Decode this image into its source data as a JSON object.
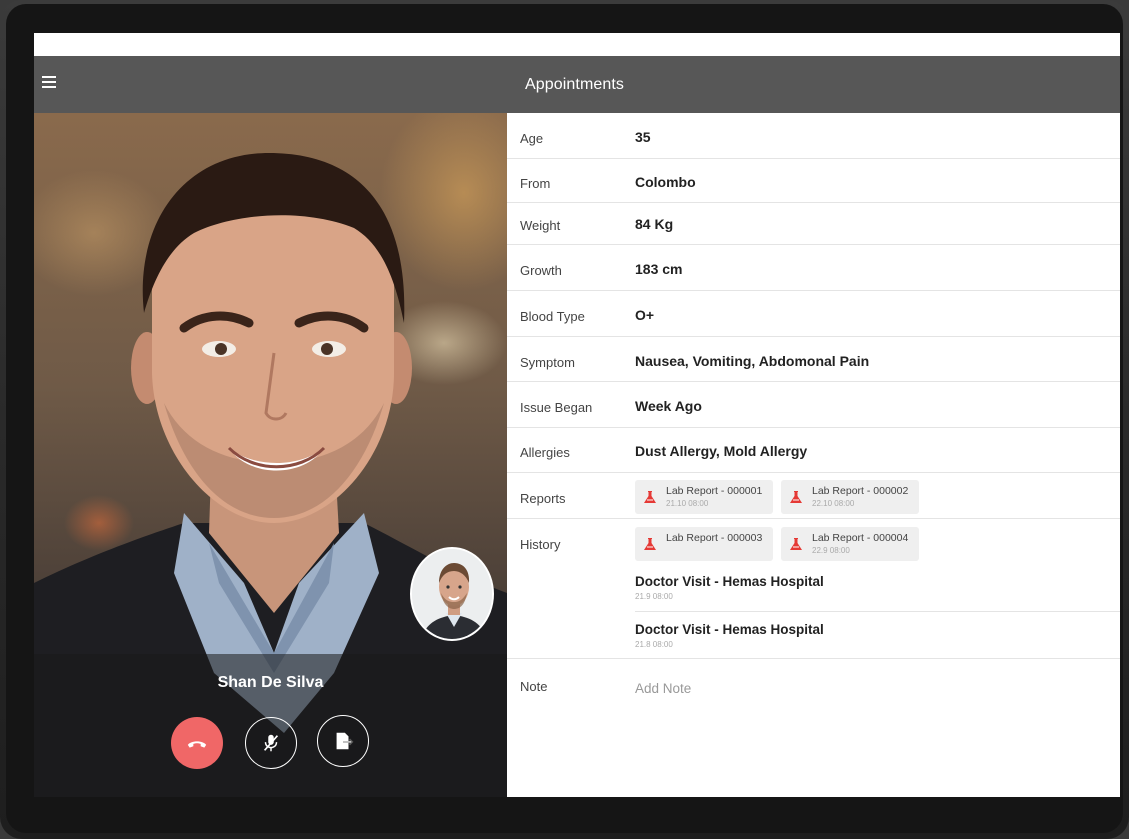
{
  "app": {
    "title": "Appointments"
  },
  "colors": {
    "header": "#575757",
    "end_call": "#f06767",
    "lab_icon": "#e53935"
  },
  "call": {
    "caller_name": "Shan De Silva",
    "buttons": [
      {
        "name": "end-call-button",
        "icon": "phone-hangup-icon"
      },
      {
        "name": "mute-button",
        "icon": "microphone-off-icon"
      },
      {
        "name": "share-button",
        "icon": "share-document-icon"
      }
    ]
  },
  "patient": {
    "rows": [
      {
        "label": "Age",
        "value": "35"
      },
      {
        "label": "From",
        "value": "Colombo"
      },
      {
        "label": "Weight",
        "value": "84 Kg"
      },
      {
        "label": "Growth",
        "value": "183 cm"
      },
      {
        "label": "Blood Type",
        "value": "O+"
      },
      {
        "label": "Symptom",
        "value": "Nausea, Vomiting, Abdomonal Pain"
      },
      {
        "label": "Issue Began",
        "value": "Week Ago"
      },
      {
        "label": "Allergies",
        "value": "Dust Allergy, Mold Allergy"
      }
    ],
    "reports_label": "Reports",
    "reports": [
      {
        "title": "Lab Report - 000001",
        "date": "21.10 08:00"
      },
      {
        "title": "Lab Report - 000002",
        "date": "22.10 08:00"
      }
    ],
    "history_label": "History",
    "history_reports": [
      {
        "title": "Lab Report - 000003",
        "date": ""
      },
      {
        "title": "Lab Report - 000004",
        "date": "22.9 08:00"
      }
    ],
    "visits": [
      {
        "title": "Doctor Visit - Hemas Hospital",
        "date": "21.9 08:00"
      },
      {
        "title": "Doctor Visit - Hemas Hospital",
        "date": "21.8 08:00"
      }
    ],
    "note_label": "Note",
    "note_placeholder": "Add Note",
    "note_value": ""
  }
}
